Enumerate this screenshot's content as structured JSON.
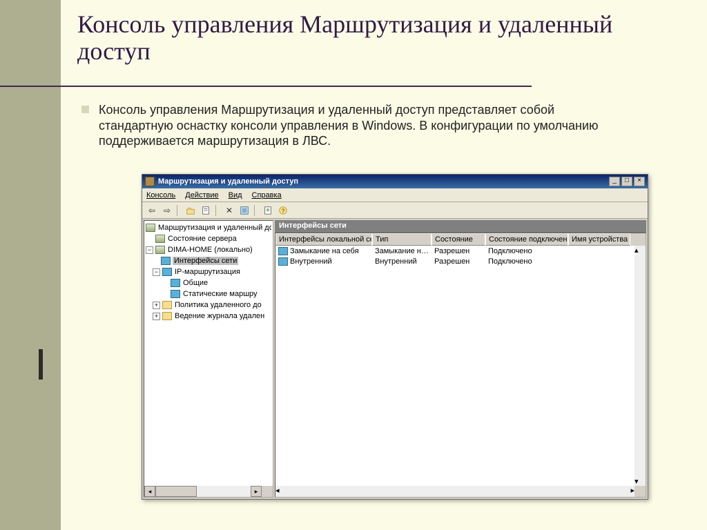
{
  "slide": {
    "title": "Консоль управления Маршрутизация и удаленный доступ",
    "bullet": "Консоль управления Маршрутизация и удаленный доступ представляет собой стандартную оснастку консоли управления в Windows. В конфигурации по умолчанию поддерживается маршрутизация в ЛВС."
  },
  "window": {
    "title": "Маршрутизация и удаленный доступ",
    "menu": {
      "console": "Консоль",
      "action": "Действие",
      "view": "Вид",
      "help": "Справка"
    },
    "tree": {
      "root": "Маршрутизация и удаленный до",
      "items": [
        "Состояние сервера",
        "DIMA-HOME (локально)",
        "Интерфейсы сети",
        "IP-маршрутизация",
        "Общие",
        "Статические маршру",
        "Политика удаленного до",
        "Ведение журнала удален"
      ]
    },
    "list_title": "Интерфейсы сети",
    "columns": [
      "Интерфейсы локальной сети и …",
      "Тип",
      "Состояние",
      "Состояние подключения",
      "Имя устройства"
    ],
    "rows": [
      {
        "name": "Замыкание на себя",
        "type": "Замыкание н…",
        "state": "Разрешен",
        "conn": "Подключено",
        "dev": ""
      },
      {
        "name": "Внутренний",
        "type": "Внутренний",
        "state": "Разрешен",
        "conn": "Подключено",
        "dev": ""
      }
    ]
  }
}
